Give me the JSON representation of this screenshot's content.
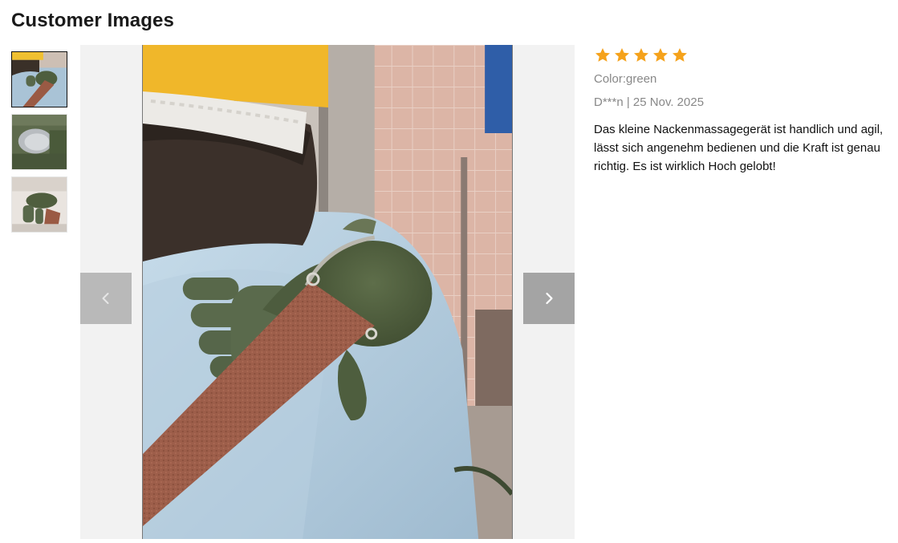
{
  "header": {
    "title": "Customer Images"
  },
  "thumbnails": [
    {
      "name": "thumbnail-1",
      "active": true
    },
    {
      "name": "thumbnail-2",
      "active": false
    },
    {
      "name": "thumbnail-3",
      "active": false
    }
  ],
  "viewer": {
    "prev_icon": "chevron-left-icon",
    "next_icon": "chevron-right-icon"
  },
  "review": {
    "rating": 5,
    "rating_max": 5,
    "star_color": "#f5a21b",
    "color_label": "Color:green",
    "author_date": "D***n | 25 Nov. 2025",
    "text": "Das kleine Nackenmassagegerät ist handlich und agil, lässt sich angenehm bedienen und die Kraft ist genau richtig. Es ist wirklich Hoch gelobt!"
  }
}
